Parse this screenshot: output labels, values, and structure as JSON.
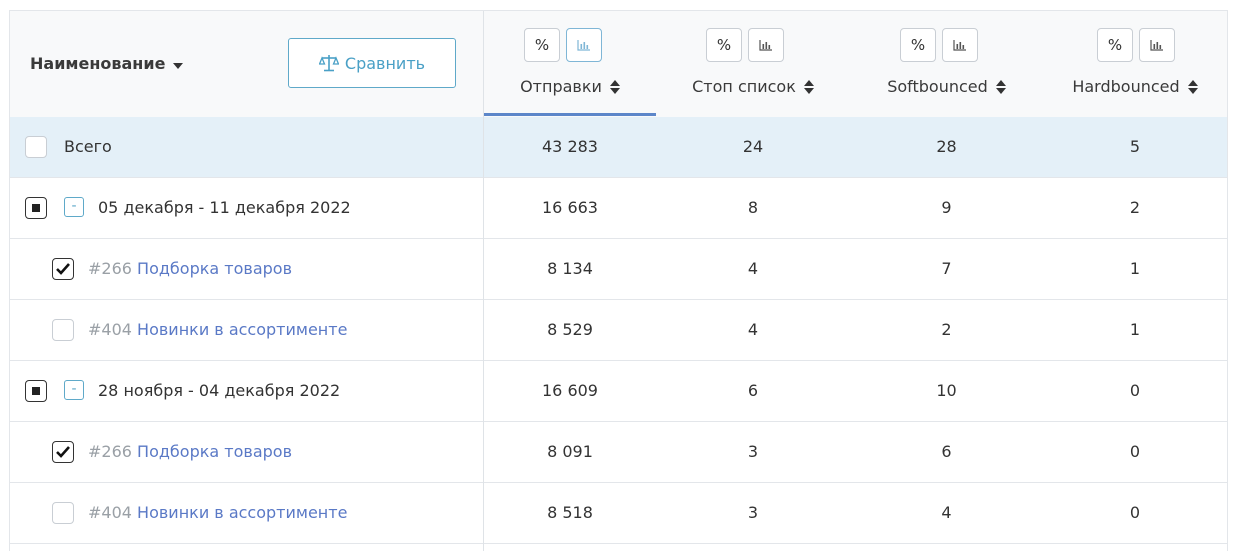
{
  "header": {
    "name_label": "Наименование",
    "compare_label": "Сравнить",
    "accent": "#5fa9c9",
    "columns": [
      {
        "label": "Отправки",
        "pct": "%",
        "active": true
      },
      {
        "label": "Стоп список",
        "pct": "%",
        "active": false
      },
      {
        "label": "Softbounced",
        "pct": "%",
        "active": false
      },
      {
        "label": "Hardbounced",
        "pct": "%",
        "active": false
      }
    ]
  },
  "rows": [
    {
      "type": "total",
      "label": "Всего",
      "checked": false,
      "values": [
        "43 283",
        "24",
        "28",
        "5"
      ]
    },
    {
      "type": "group",
      "label": "05 декабря - 11 декабря 2022",
      "state": "partial",
      "toggle": "-",
      "values": [
        "16 663",
        "8",
        "9",
        "2"
      ]
    },
    {
      "type": "campaign",
      "id": "#266",
      "name": "Подборка товаров",
      "checked": true,
      "values": [
        "8 134",
        "4",
        "7",
        "1"
      ]
    },
    {
      "type": "campaign",
      "id": "#404",
      "name": "Новинки в ассортименте",
      "checked": false,
      "values": [
        "8 529",
        "4",
        "2",
        "1"
      ]
    },
    {
      "type": "group",
      "label": "28 ноября - 04 декабря 2022",
      "state": "partial",
      "toggle": "-",
      "values": [
        "16 609",
        "6",
        "10",
        "0"
      ]
    },
    {
      "type": "campaign",
      "id": "#266",
      "name": "Подборка товаров",
      "checked": true,
      "values": [
        "8 091",
        "3",
        "6",
        "0"
      ]
    },
    {
      "type": "campaign",
      "id": "#404",
      "name": "Новинки в ассортименте",
      "checked": false,
      "values": [
        "8 518",
        "3",
        "4",
        "0"
      ]
    }
  ]
}
